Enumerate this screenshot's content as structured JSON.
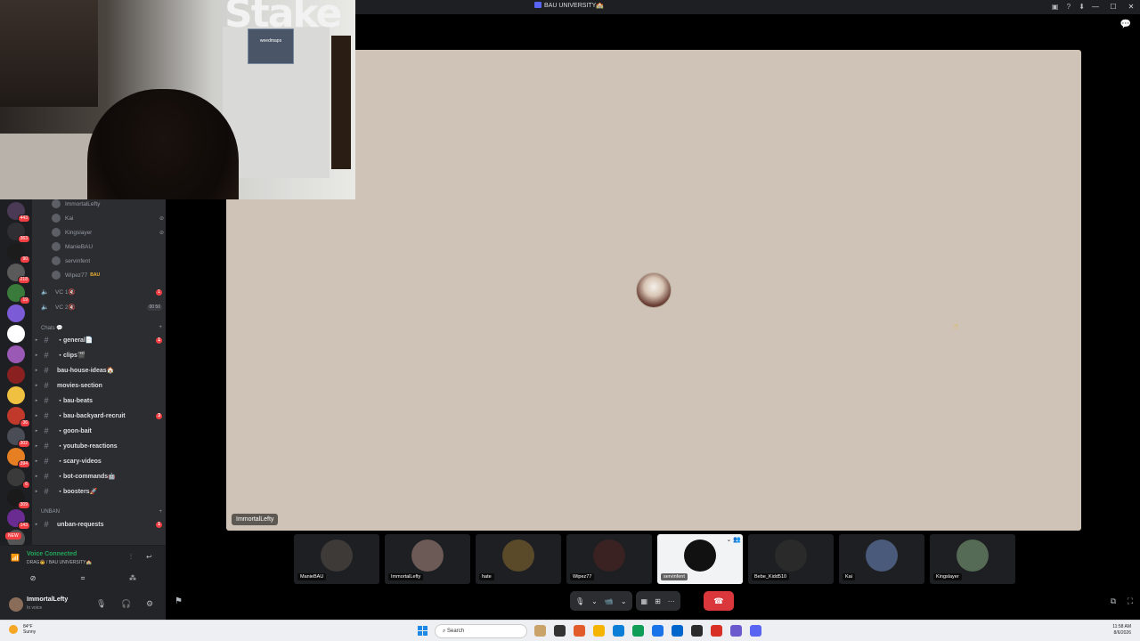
{
  "window": {
    "title": "BAU UNIVERSITY",
    "title_emoji": "🏫",
    "controls": [
      "—",
      "☐",
      "✕"
    ],
    "toolbar_icons": [
      "inbox-icon",
      "help-icon",
      "download-icon"
    ]
  },
  "webcam": {
    "brand": "Stake",
    "banner": "weedmaps"
  },
  "server_rail": {
    "badges": [
      "443",
      "363",
      "90",
      "218",
      "19",
      "",
      "",
      "",
      "",
      "",
      "36",
      "302",
      "394",
      "6",
      "309",
      "143",
      "",
      ""
    ],
    "new_label": "NEW"
  },
  "voice_users": [
    {
      "name": "ImmortalLefty",
      "muted": false,
      "tag": ""
    },
    {
      "name": "Kai",
      "muted": true,
      "tag": ""
    },
    {
      "name": "Kingslayer",
      "muted": true,
      "tag": ""
    },
    {
      "name": "ManieBAU",
      "muted": false,
      "tag": ""
    },
    {
      "name": "servinfent",
      "muted": false,
      "tag": ""
    },
    {
      "name": "Wipez77",
      "muted": false,
      "tag": "BAU"
    }
  ],
  "voice_channels": [
    {
      "name": "VC 1🔇",
      "count": "1",
      "gray": false
    },
    {
      "name": "VC 2🔇",
      "count": "00 50",
      "gray": true
    }
  ],
  "categories": {
    "chats": "Chats 💬",
    "unban": "UNBAN"
  },
  "channels": [
    {
      "name": "・general📄",
      "unread": "1"
    },
    {
      "name": "・clips🎬",
      "unread": ""
    },
    {
      "name": "bau-house-ideas🏠",
      "unread": ""
    },
    {
      "name": "movies-section",
      "unread": ""
    },
    {
      "name": "・bau-beats",
      "unread": ""
    },
    {
      "name": "・bau-backyard-recruit",
      "unread": "3"
    },
    {
      "name": "・goon-bait",
      "unread": ""
    },
    {
      "name": "・youtube-reactions",
      "unread": ""
    },
    {
      "name": "・scary-videos",
      "unread": ""
    },
    {
      "name": "・bot-commands🤖",
      "unread": ""
    },
    {
      "name": "・boosters🚀",
      "unread": ""
    }
  ],
  "unban_channels": [
    {
      "name": "unban-requests",
      "unread": "1"
    }
  ],
  "voice_panel": {
    "status": "Voice Connected",
    "location": "DRAG🤠 / BAU UNIVERSITY🏫"
  },
  "user_panel": {
    "username": "ImmortalLefty",
    "status": "In voice"
  },
  "stage": {
    "speaker_label": "ImmortalLefty"
  },
  "participants": [
    {
      "name": "ManieBAU",
      "active": false,
      "mobile": true
    },
    {
      "name": "ImmortalLefty",
      "active": false,
      "mobile": false
    },
    {
      "name": "hate",
      "active": false,
      "mobile": true
    },
    {
      "name": "Wipez77",
      "active": false,
      "mobile": true
    },
    {
      "name": "servinfent",
      "active": true,
      "mobile": false
    },
    {
      "name": "Bebe_Kidd510",
      "active": false,
      "mobile": true
    },
    {
      "name": "Kai",
      "active": false,
      "mobile": false
    },
    {
      "name": "Kingslayer",
      "active": false,
      "mobile": true
    }
  ],
  "participant_colors": [
    "#3d3a38",
    "#6b5a55",
    "#5a4a2a",
    "#3a2222",
    "#f2f3f5",
    "#2a2a2a",
    "#4a5a7a",
    "#556b55"
  ],
  "controls": {
    "mic": "🎙",
    "camera": "📹",
    "activities": "▦",
    "screen": "⊞",
    "more": "···",
    "leave": "☎"
  },
  "taskbar": {
    "weather_temp": "84°F",
    "weather_desc": "Sunny",
    "search": "Search",
    "time": "11:58 AM",
    "date": "8/6/2026",
    "app_colors": [
      "#c9a36a",
      "#333",
      "#e25c2b",
      "#f4b400",
      "#0b7ed8",
      "#0f9d58",
      "#1a73e8",
      "#0066cc",
      "#2b2b2b",
      "#d93025",
      "#6a5acd",
      "#5865f2"
    ]
  }
}
